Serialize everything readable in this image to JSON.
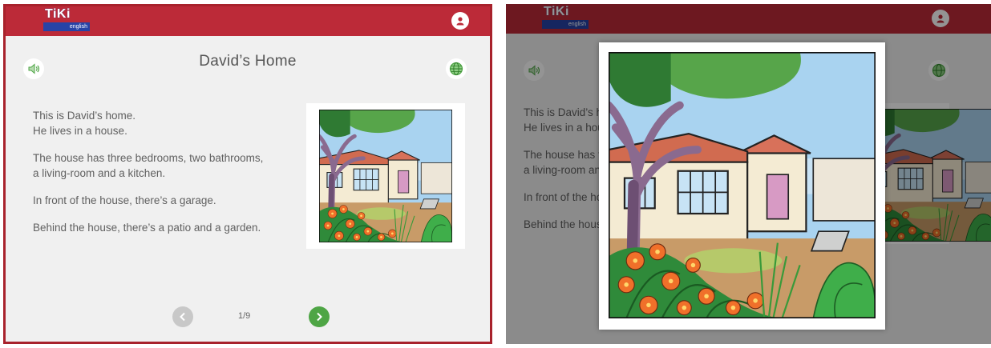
{
  "app": {
    "logo_text": "TiKi",
    "logo_sub": "english"
  },
  "lesson": {
    "title": "David’s Home",
    "paragraphs": [
      "This is David’s home.\nHe lives in a house.",
      "The house has three bedrooms, two bathrooms,\na living-room and a kitchen.",
      "In front of the house, there’s a garage.",
      "Behind the house, there’s a patio and a garden."
    ],
    "page_indicator": "1/9"
  },
  "colors": {
    "header": "#bc2a38",
    "border": "#a8222c",
    "accent_green": "#4ea545",
    "text": "#606060"
  },
  "icons": {
    "audio": "speaker-icon",
    "translate": "globe-icon",
    "user": "user-icon",
    "prev": "chevron-left-icon",
    "next": "chevron-right-icon"
  }
}
